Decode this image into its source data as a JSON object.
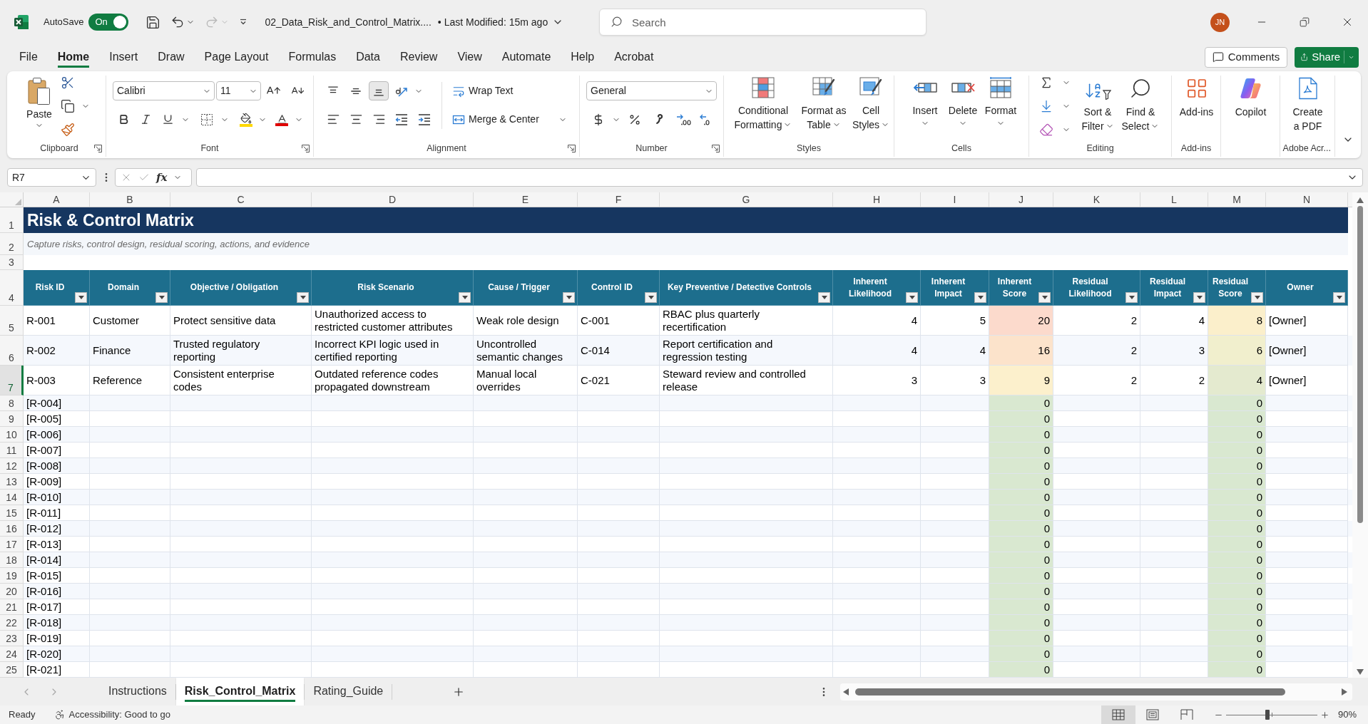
{
  "title_bar": {
    "autosave_label": "AutoSave",
    "autosave_toggle": {
      "label": "On",
      "on": true
    },
    "redo": {
      "disabled": true
    },
    "file_name": "02_Data_Risk_and_Control_Matrix....",
    "last_modified": "• Last Modified: 15m ago",
    "search": {
      "placeholder": "Search"
    },
    "user_initials": "JN"
  },
  "menu_tabs": [
    {
      "label": "File",
      "selected": false
    },
    {
      "label": "Home",
      "selected": true
    },
    {
      "label": "Insert",
      "selected": false
    },
    {
      "label": "Draw",
      "selected": false
    },
    {
      "label": "Page Layout",
      "selected": false
    },
    {
      "label": "Formulas",
      "selected": false
    },
    {
      "label": "Data",
      "selected": false
    },
    {
      "label": "Review",
      "selected": false
    },
    {
      "label": "View",
      "selected": false
    },
    {
      "label": "Automate",
      "selected": false
    },
    {
      "label": "Help",
      "selected": false
    },
    {
      "label": "Acrobat",
      "selected": false
    }
  ],
  "header_buttons": {
    "comments": "Comments",
    "share": "Share"
  },
  "ribbon": {
    "clipboard": {
      "label": "Clipboard",
      "paste": "Paste"
    },
    "font": {
      "label": "Font",
      "font_name": "Calibri",
      "font_size": "11"
    },
    "alignment": {
      "label": "Alignment",
      "vertical_align": [
        {
          "kind": "top",
          "selected": false
        },
        {
          "kind": "middle",
          "selected": false
        },
        {
          "kind": "bottom",
          "selected": true
        }
      ],
      "wrap_text": "Wrap Text",
      "merge_center": "Merge & Center"
    },
    "number": {
      "label": "Number",
      "format": "General"
    },
    "styles": {
      "label": "Styles",
      "buttons": [
        "Conditional Formatting",
        "Format as Table",
        "Cell Styles"
      ]
    },
    "cells": {
      "label": "Cells",
      "buttons": [
        "Insert",
        "Delete",
        "Format"
      ]
    },
    "editing": {
      "label": "Editing",
      "buttons": [
        "Sort & Filter",
        "Find & Select"
      ]
    },
    "add_ins": {
      "label": "Add-ins",
      "button": "Add-ins"
    },
    "copilot": {
      "button": "Copilot"
    },
    "adobe": {
      "label": "Adobe Acr...",
      "button": "Create a PDF"
    }
  },
  "formula_bar": {
    "name_box": "R7",
    "function_label": "fx"
  },
  "sheet": {
    "column_headers": [
      "A",
      "B",
      "C",
      "D",
      "E",
      "F",
      "G",
      "H",
      "I",
      "J",
      "K",
      "L",
      "M",
      "N"
    ],
    "row_numbers": [
      {
        "label": "1",
        "selected": false
      },
      {
        "label": "2",
        "selected": false
      },
      {
        "label": "3",
        "selected": false
      },
      {
        "label": "4",
        "selected": false
      },
      {
        "label": "5",
        "selected": false
      },
      {
        "label": "6",
        "selected": false
      },
      {
        "label": "7",
        "selected": true
      },
      {
        "label": "8",
        "selected": false
      },
      {
        "label": "9",
        "selected": false
      },
      {
        "label": "10",
        "selected": false
      },
      {
        "label": "11",
        "selected": false
      },
      {
        "label": "12",
        "selected": false
      },
      {
        "label": "13",
        "selected": false
      },
      {
        "label": "14",
        "selected": false
      },
      {
        "label": "15",
        "selected": false
      },
      {
        "label": "16",
        "selected": false
      },
      {
        "label": "17",
        "selected": false
      },
      {
        "label": "18",
        "selected": false
      },
      {
        "label": "19",
        "selected": false
      },
      {
        "label": "20",
        "selected": false
      },
      {
        "label": "21",
        "selected": false
      },
      {
        "label": "22",
        "selected": false
      },
      {
        "label": "23",
        "selected": false
      },
      {
        "label": "24",
        "selected": false
      },
      {
        "label": "25",
        "selected": false
      }
    ],
    "title": "Risk & Control Matrix",
    "subtitle": "Capture risks, control design, residual scoring, actions, and evidence",
    "table": {
      "columns": [
        "Risk ID",
        "Domain",
        "Objective / Obligation",
        "Risk Scenario",
        "Cause / Trigger",
        "Control ID",
        "Key Preventive / Detective Controls",
        "Inherent Likelihood",
        "Inherent Impact",
        "Inherent Score",
        "Residual Likelihood",
        "Residual Impact",
        "Residual Score",
        "Owner"
      ],
      "rows": [
        {
          "risk_id": "R-001",
          "domain": "Customer",
          "objective": "Protect sensitive data",
          "scenario": "Unauthorized access to restricted customer attributes",
          "cause": "Weak role design",
          "control_id": "C-001",
          "controls": "RBAC plus quarterly recertification",
          "inherent_likelihood": "4",
          "inherent_impact": "5",
          "inherent_score": {
            "value": "20",
            "color": "#fcdacc"
          },
          "residual_likelihood": "2",
          "residual_impact": "4",
          "residual_score": {
            "value": "8",
            "color": "#fbefcb"
          },
          "owner": "[Owner]"
        },
        {
          "risk_id": "R-002",
          "domain": "Finance",
          "objective": "Trusted regulatory reporting",
          "scenario": "Incorrect KPI logic used in certified reporting",
          "cause": "Uncontrolled semantic changes",
          "control_id": "C-014",
          "controls": "Report certification and regression testing",
          "inherent_likelihood": "4",
          "inherent_impact": "4",
          "inherent_score": {
            "value": "16",
            "color": "#fce3cb"
          },
          "residual_likelihood": "2",
          "residual_impact": "3",
          "residual_score": {
            "value": "6",
            "color": "#f1efcd"
          },
          "owner": "[Owner]"
        },
        {
          "risk_id": "R-003",
          "domain": "Reference",
          "objective": "Consistent enterprise codes",
          "scenario": "Outdated reference codes propagated downstream",
          "cause": "Manual local overrides",
          "control_id": "C-021",
          "controls": "Steward review and controlled release",
          "inherent_likelihood": "3",
          "inherent_impact": "3",
          "inherent_score": {
            "value": "9",
            "color": "#fcf0cc"
          },
          "residual_likelihood": "2",
          "residual_impact": "2",
          "residual_score": {
            "value": "4",
            "color": "#e4eacf"
          },
          "owner": "[Owner]"
        },
        {
          "risk_id": "[R-004]",
          "inherent_score": {
            "value": "0",
            "color": "#d9e8d0"
          },
          "residual_score": {
            "value": "0",
            "color": "#d9e8d0"
          }
        },
        {
          "risk_id": "[R-005]",
          "inherent_score": {
            "value": "0",
            "color": "#d9e8d0"
          },
          "residual_score": {
            "value": "0",
            "color": "#d9e8d0"
          }
        },
        {
          "risk_id": "[R-006]",
          "inherent_score": {
            "value": "0",
            "color": "#d9e8d0"
          },
          "residual_score": {
            "value": "0",
            "color": "#d9e8d0"
          }
        },
        {
          "risk_id": "[R-007]",
          "inherent_score": {
            "value": "0",
            "color": "#d9e8d0"
          },
          "residual_score": {
            "value": "0",
            "color": "#d9e8d0"
          }
        },
        {
          "risk_id": "[R-008]",
          "inherent_score": {
            "value": "0",
            "color": "#d9e8d0"
          },
          "residual_score": {
            "value": "0",
            "color": "#d9e8d0"
          }
        },
        {
          "risk_id": "[R-009]",
          "inherent_score": {
            "value": "0",
            "color": "#d9e8d0"
          },
          "residual_score": {
            "value": "0",
            "color": "#d9e8d0"
          }
        },
        {
          "risk_id": "[R-010]",
          "inherent_score": {
            "value": "0",
            "color": "#d9e8d0"
          },
          "residual_score": {
            "value": "0",
            "color": "#d9e8d0"
          }
        },
        {
          "risk_id": "[R-011]",
          "inherent_score": {
            "value": "0",
            "color": "#d9e8d0"
          },
          "residual_score": {
            "value": "0",
            "color": "#d9e8d0"
          }
        },
        {
          "risk_id": "[R-012]",
          "inherent_score": {
            "value": "0",
            "color": "#d9e8d0"
          },
          "residual_score": {
            "value": "0",
            "color": "#d9e8d0"
          }
        },
        {
          "risk_id": "[R-013]",
          "inherent_score": {
            "value": "0",
            "color": "#d9e8d0"
          },
          "residual_score": {
            "value": "0",
            "color": "#d9e8d0"
          }
        },
        {
          "risk_id": "[R-014]",
          "inherent_score": {
            "value": "0",
            "color": "#d9e8d0"
          },
          "residual_score": {
            "value": "0",
            "color": "#d9e8d0"
          }
        },
        {
          "risk_id": "[R-015]",
          "inherent_score": {
            "value": "0",
            "color": "#d9e8d0"
          },
          "residual_score": {
            "value": "0",
            "color": "#d9e8d0"
          }
        },
        {
          "risk_id": "[R-016]",
          "inherent_score": {
            "value": "0",
            "color": "#d9e8d0"
          },
          "residual_score": {
            "value": "0",
            "color": "#d9e8d0"
          }
        },
        {
          "risk_id": "[R-017]",
          "inherent_score": {
            "value": "0",
            "color": "#d9e8d0"
          },
          "residual_score": {
            "value": "0",
            "color": "#d9e8d0"
          }
        },
        {
          "risk_id": "[R-018]",
          "inherent_score": {
            "value": "0",
            "color": "#d9e8d0"
          },
          "residual_score": {
            "value": "0",
            "color": "#d9e8d0"
          }
        },
        {
          "risk_id": "[R-019]",
          "inherent_score": {
            "value": "0",
            "color": "#d9e8d0"
          },
          "residual_score": {
            "value": "0",
            "color": "#d9e8d0"
          }
        },
        {
          "risk_id": "[R-020]",
          "inherent_score": {
            "value": "0",
            "color": "#d9e8d0"
          },
          "residual_score": {
            "value": "0",
            "color": "#d9e8d0"
          }
        },
        {
          "risk_id": "[R-021]",
          "inherent_score": {
            "value": "0",
            "color": "#d9e8d0"
          },
          "residual_score": {
            "value": "0",
            "color": "#d9e8d0"
          }
        }
      ]
    }
  },
  "sheet_tabs": [
    {
      "label": "Instructions",
      "selected": false
    },
    {
      "label": "Risk_Control_Matrix",
      "selected": true
    },
    {
      "label": "Rating_Guide",
      "selected": false
    }
  ],
  "status_bar": {
    "status": "Ready",
    "accessibility": "Accessibility: Good to go",
    "views": [
      {
        "kind": "normal",
        "selected": true
      },
      {
        "kind": "page_layout",
        "selected": false
      },
      {
        "kind": "page_break",
        "selected": false
      }
    ],
    "zoom": {
      "level": 0.45,
      "reading": "90%"
    }
  }
}
